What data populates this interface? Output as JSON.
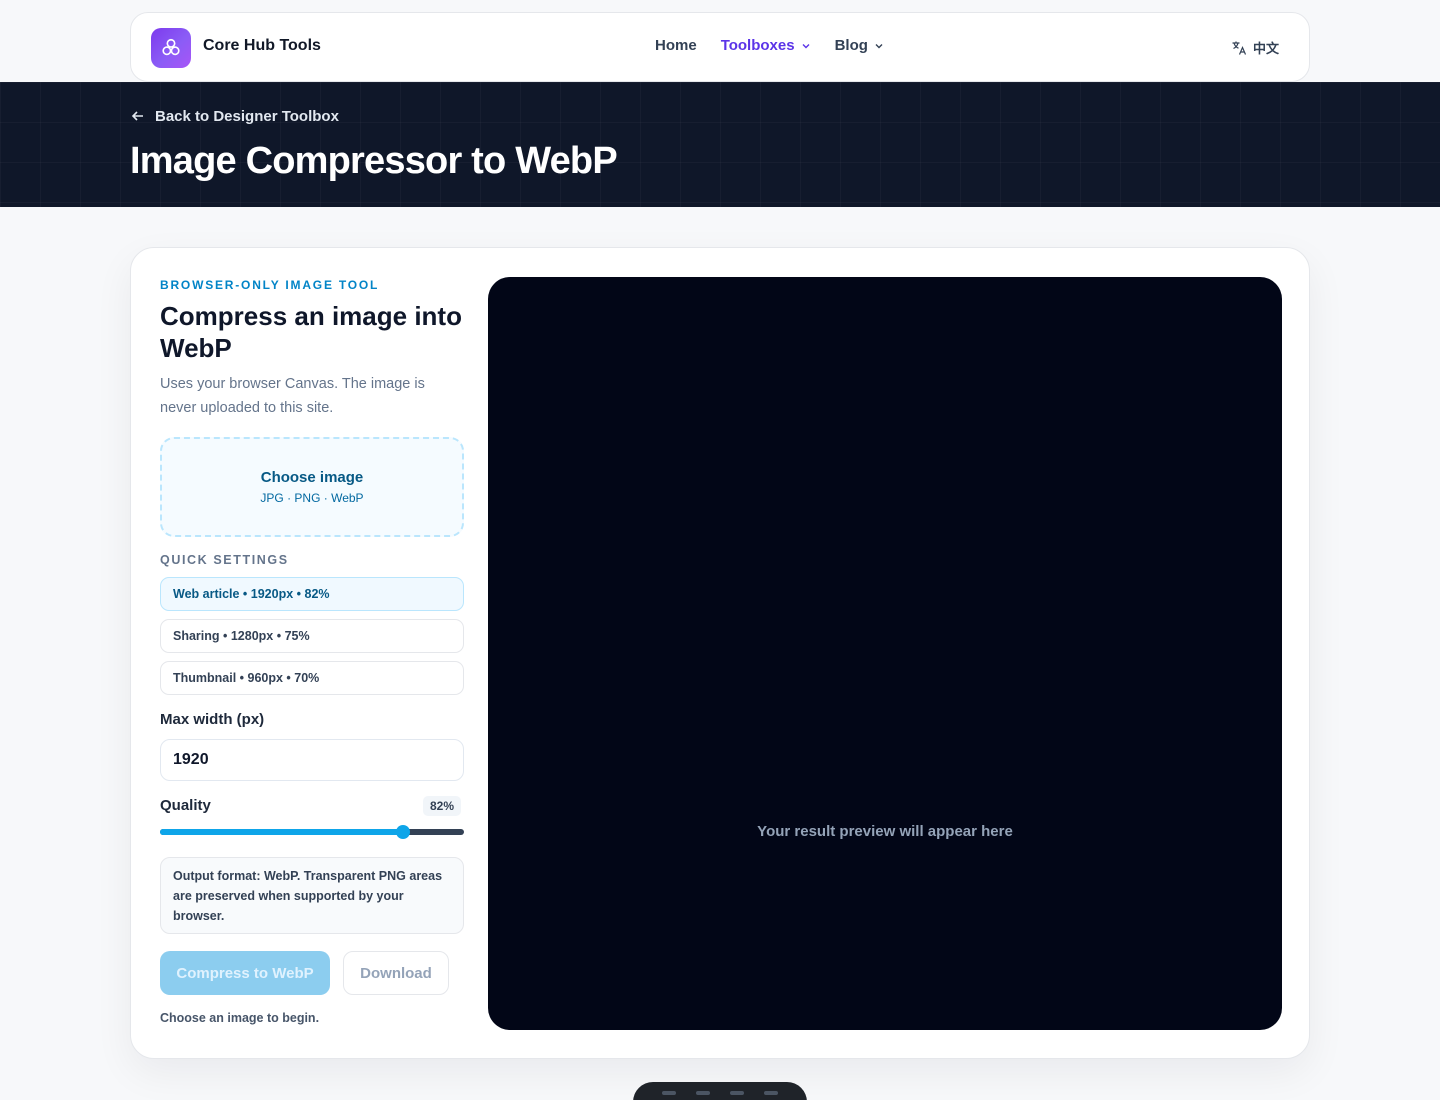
{
  "header": {
    "brand": "Core Hub Tools",
    "nav": [
      {
        "label": "Home"
      },
      {
        "label": "Toolboxes"
      },
      {
        "label": "Blog"
      }
    ],
    "lang_label": "中文"
  },
  "hero": {
    "back_label": "Back to Designer Toolbox",
    "title": "Image Compressor to WebP"
  },
  "tool": {
    "eyebrow": "BROWSER-ONLY IMAGE TOOL",
    "title": "Compress an image into WebP",
    "description": "Uses your browser Canvas. The image is never uploaded to this site.",
    "dropzone": {
      "title": "Choose image",
      "formats": "JPG · PNG · WebP"
    },
    "quick_settings_label": "QUICK SETTINGS",
    "presets": [
      {
        "label": "Web article • 1920px • 82%",
        "active": true
      },
      {
        "label": "Sharing • 1280px • 75%",
        "active": false
      },
      {
        "label": "Thumbnail • 960px • 70%",
        "active": false
      }
    ],
    "max_width_label": "Max width (px)",
    "max_width_value": "1920",
    "quality_label": "Quality",
    "quality_value": 82,
    "quality_display": "82%",
    "note": "Output format: WebP. Transparent PNG areas are preserved when supported by your browser.",
    "compress_label": "Compress to WebP",
    "download_label": "Download",
    "status": "Choose an image to begin.",
    "preview_placeholder": "Your result preview will appear here"
  }
}
